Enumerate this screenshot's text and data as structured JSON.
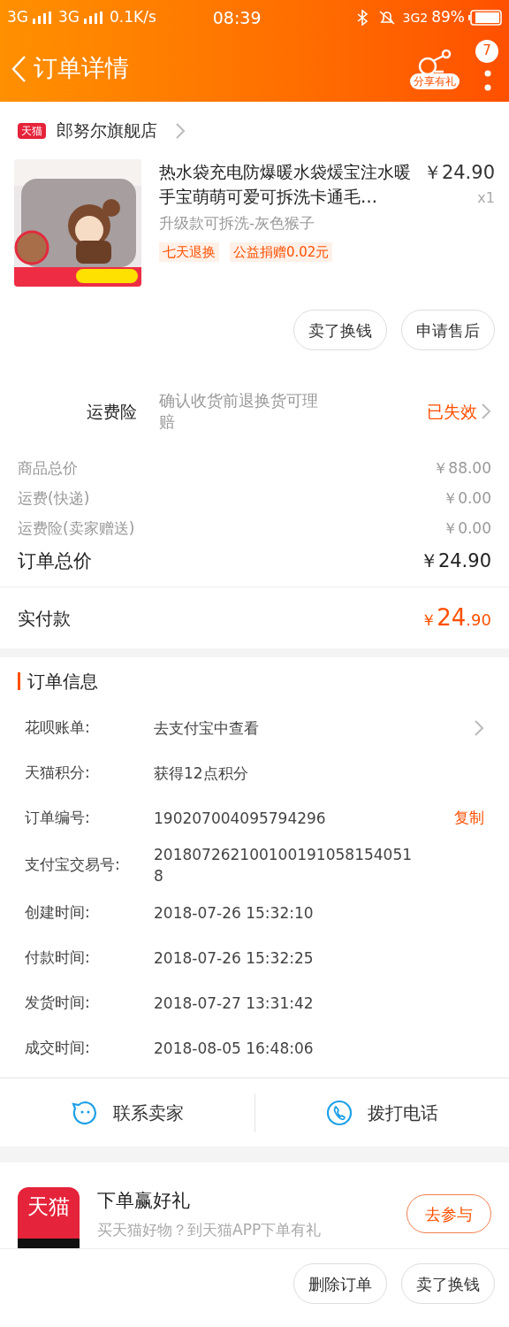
{
  "status_bar": {
    "net1": "3G",
    "net2": "3G",
    "speed": "0.1K/s",
    "time": "08:39",
    "net3": "3G2",
    "battery": "89%"
  },
  "header": {
    "title": "订单详情",
    "share_label": "分享有礼",
    "badge": "7"
  },
  "store": {
    "logo_text": "天猫",
    "name": "郎努尔旗舰店"
  },
  "product": {
    "title": "热水袋充电防爆暖水袋煖宝注水暖手宝萌萌可爱可拆洗卡通毛…",
    "price": "￥24.90",
    "qty": "x1",
    "variant": "升级款可拆洗-灰色猴子",
    "tags": [
      "七天退换",
      "公益捐赠0.02元"
    ]
  },
  "item_buttons": [
    "卖了换钱",
    "申请售后"
  ],
  "insurance": {
    "label": "运费险",
    "description": "确认收货前退换货可理赔",
    "status": "已失效"
  },
  "prices": [
    {
      "kind": "minor",
      "label": "商品总价",
      "value": "￥88.00"
    },
    {
      "kind": "minor",
      "label": "运费(快递)",
      "value": "￥0.00"
    },
    {
      "kind": "minor",
      "label": "运费险(卖家赠送)",
      "value": "￥0.00"
    },
    {
      "kind": "total",
      "label": "订单总价",
      "value": "￥24.90"
    }
  ],
  "paid": {
    "label": "实付款",
    "currency": "￥",
    "integer": "24",
    "decimal": ".90"
  },
  "order_info": {
    "title": "订单信息",
    "rows": [
      {
        "label": "花呗账单:",
        "value": "去支付宝中查看",
        "arrow": true
      },
      {
        "label": "天猫积分:",
        "value": "获得12点积分",
        "arrow": false
      },
      {
        "label": "订单编号:",
        "value": "190207004095794296",
        "action": "复制",
        "arrow": false
      },
      {
        "label": "支付宝交易号:",
        "value": "2018072621001001910581540518",
        "arrow": false
      },
      {
        "label": "创建时间:",
        "value": "2018-07-26 15:32:10",
        "arrow": false
      },
      {
        "label": "付款时间:",
        "value": "2018-07-26 15:32:25",
        "arrow": false
      },
      {
        "label": "发货时间:",
        "value": "2018-07-27 13:31:42",
        "arrow": false
      },
      {
        "label": "成交时间:",
        "value": "2018-08-05 16:48:06",
        "arrow": false
      }
    ]
  },
  "contact": [
    {
      "kind": "chat",
      "label": "联系卖家"
    },
    {
      "kind": "phone",
      "label": "拨打电话"
    }
  ],
  "promo": {
    "logo_text": "天猫",
    "title": "下单赢好礼",
    "subtitle": "买天猫好物？到天猫APP下单有礼",
    "button": "去参与"
  },
  "bottom_buttons": [
    "删除订单",
    "卖了换钱"
  ]
}
